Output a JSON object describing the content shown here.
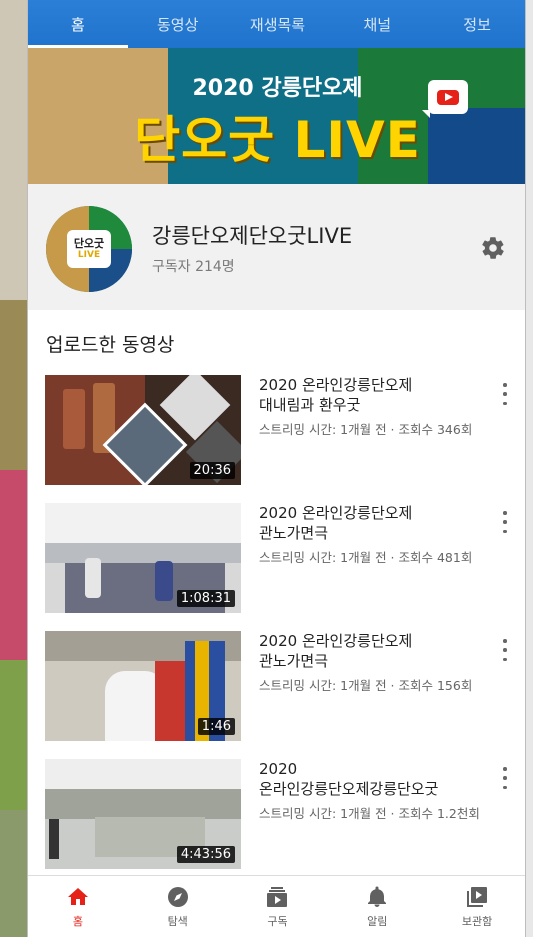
{
  "tabs": [
    {
      "label": "홈",
      "active": true
    },
    {
      "label": "동영상",
      "active": false
    },
    {
      "label": "재생목록",
      "active": false
    },
    {
      "label": "채널",
      "active": false
    },
    {
      "label": "정보",
      "active": false
    }
  ],
  "banner": {
    "subtitle": "2020 강릉단오제",
    "title": "단오굿 LIVE"
  },
  "channel": {
    "avatar_line1": "단오굿",
    "avatar_line2": "LIVE",
    "name": "강릉단오제단오굿LIVE",
    "subscribers": "구독자 214명"
  },
  "uploads": {
    "title": "업로드한 동영상",
    "videos": [
      {
        "title": "2020 온라인강릉단오제\n대내림과 환우굿",
        "meta": "스트리밍 시간: 1개월 전 · 조회수 346회",
        "duration": "20:36"
      },
      {
        "title": "2020 온라인강릉단오제\n관노가면극",
        "meta": "스트리밍 시간: 1개월 전 · 조회수 481회",
        "duration": "1:08:31"
      },
      {
        "title": "2020 온라인강릉단오제\n관노가면극",
        "meta": "스트리밍 시간: 1개월 전 · 조회수 156회",
        "duration": "1:46"
      },
      {
        "title": "2020\n온라인강릉단오제강릉단오굿",
        "meta": "스트리밍 시간: 1개월 전 · 조회수 1.2천회",
        "duration": "4:43:56"
      }
    ]
  },
  "bottom_nav": [
    {
      "label": "홈",
      "icon": "home-icon",
      "active": true
    },
    {
      "label": "탐색",
      "icon": "compass-icon",
      "active": false
    },
    {
      "label": "구독",
      "icon": "subscriptions-icon",
      "active": false
    },
    {
      "label": "알림",
      "icon": "bell-icon",
      "active": false
    },
    {
      "label": "보관함",
      "icon": "library-icon",
      "active": false
    }
  ],
  "colors": {
    "tab_bar": "#2b7fd6",
    "accent_red": "#e62117",
    "banner_yellow": "#ffd400"
  }
}
